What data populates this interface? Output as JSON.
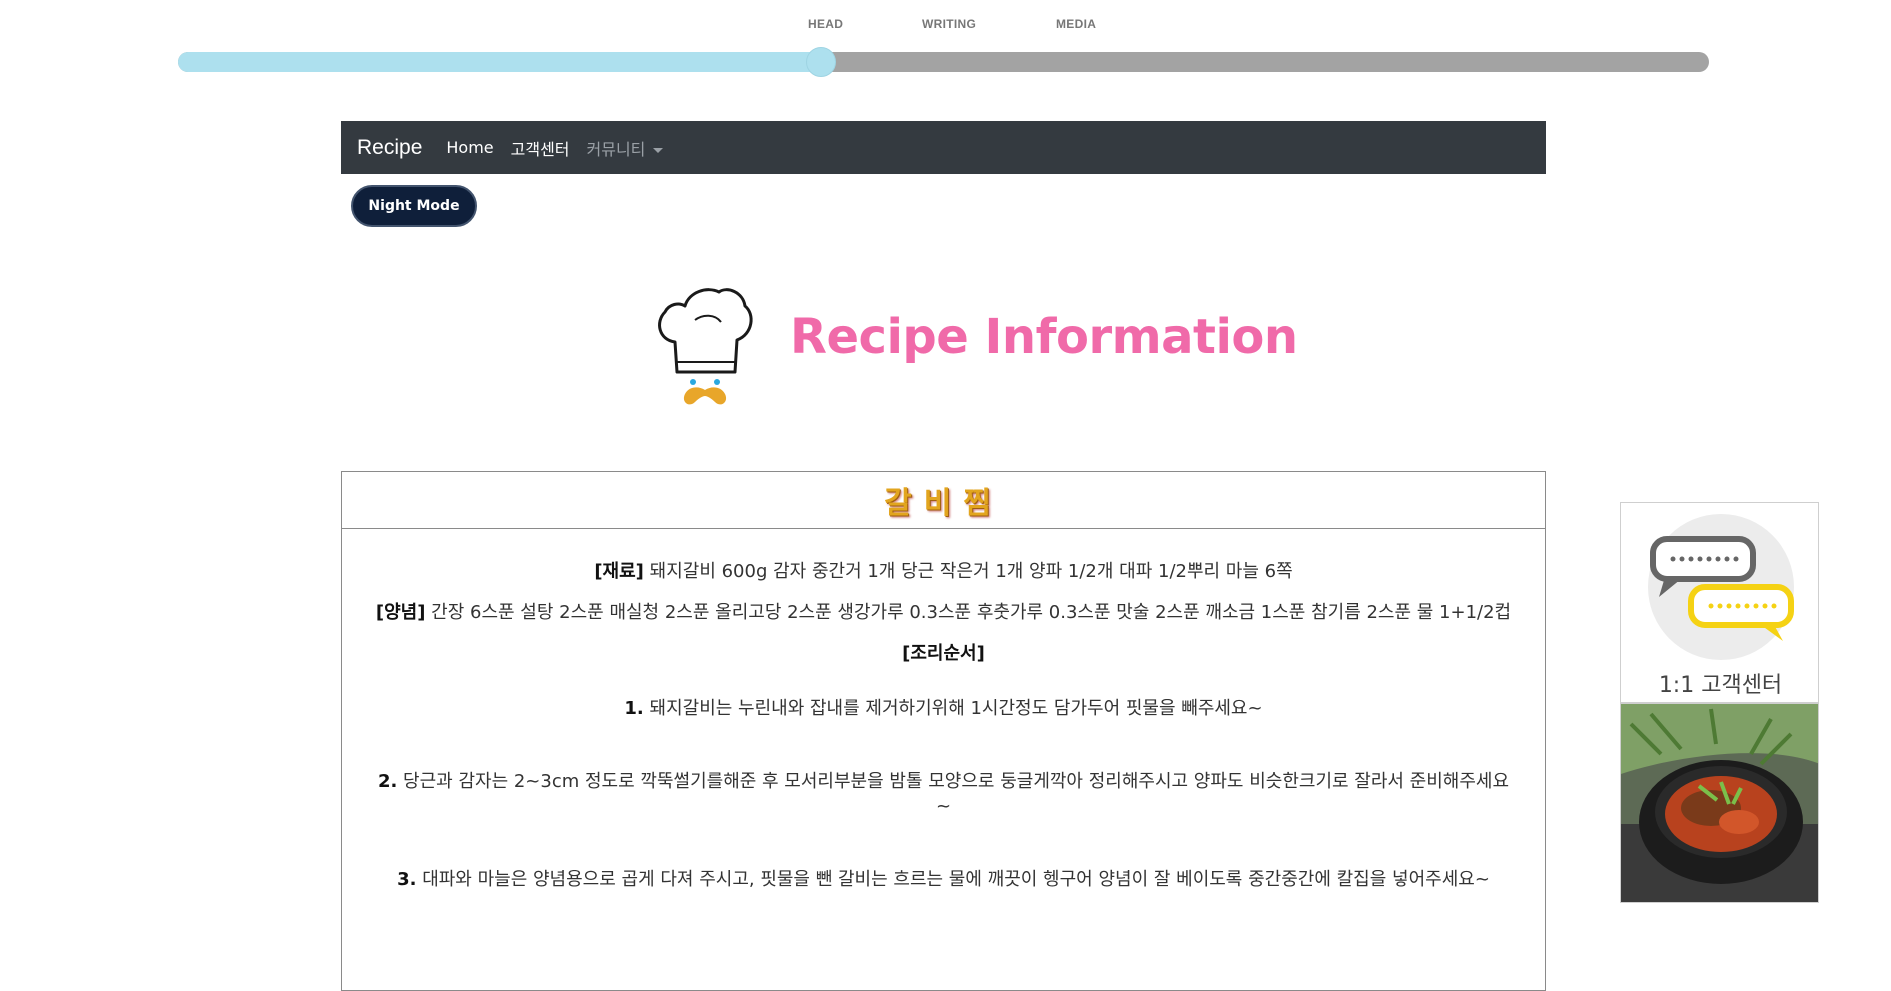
{
  "progress": {
    "labels": [
      "HEAD",
      "WRITING",
      "MEDIA"
    ],
    "value_percent": 42
  },
  "navbar": {
    "brand": "Recipe",
    "links": [
      {
        "label": "Home"
      },
      {
        "label": "고객센터"
      },
      {
        "label": "커뮤니티"
      }
    ]
  },
  "night_mode_label": "Night Mode",
  "logo": {
    "title": "Recipe Information",
    "icon": "chef-hat-icon"
  },
  "recipe": {
    "title": "갈비찜",
    "ingredients_label": "[재료]",
    "ingredients": "돼지갈비 600g 감자 중간거 1개 당근 작은거 1개 양파 1/2개 대파 1/2뿌리 마늘 6쪽",
    "sauce_label": "[양념]",
    "sauce": "간장 6스푼 설탕 2스푼 매실청 2스푼 올리고당 2스푼 생강가루 0.3스푼 후춧가루 0.3스푼 맛술 2스푼 깨소금 1스푼 참기름 2스푼 물 1+1/2컵",
    "order_label": "[조리순서]",
    "steps": [
      {
        "num": "1.",
        "text": "돼지갈비는 누린내와 잡내를 제거하기위해 1시간정도 담가두어 핏물을 빼주세요~"
      },
      {
        "num": "2.",
        "text": "당근과 감자는 2~3cm 정도로 깍뚝썰기를해준 후 모서리부분을 밤톨 모양으로 둥글게깍아 정리해주시고 양파도 비슷한크기로 잘라서 준비해주세요~"
      },
      {
        "num": "3.",
        "text": "대파와 마늘은 양념용으로 곱게 다져 주시고, 핏물을 뺀 갈비는 흐르는 물에 깨끗이 헹구어 양념이 잘 베이도록 중간중간에 칼집을 넣어주세요~"
      }
    ]
  },
  "side": {
    "cs_label": "1:1 고객센터",
    "cs_icon": "chat-bubbles-icon",
    "food_image": "stew-bowl-image"
  },
  "colors": {
    "track_fill": "#ade0ee",
    "track_bg": "#a3a3a3",
    "navbar_bg": "#343a40",
    "night_button_bg": "#0f1f3a",
    "logo_title": "#f06aa9",
    "recipe_title": "#e2a51e"
  }
}
